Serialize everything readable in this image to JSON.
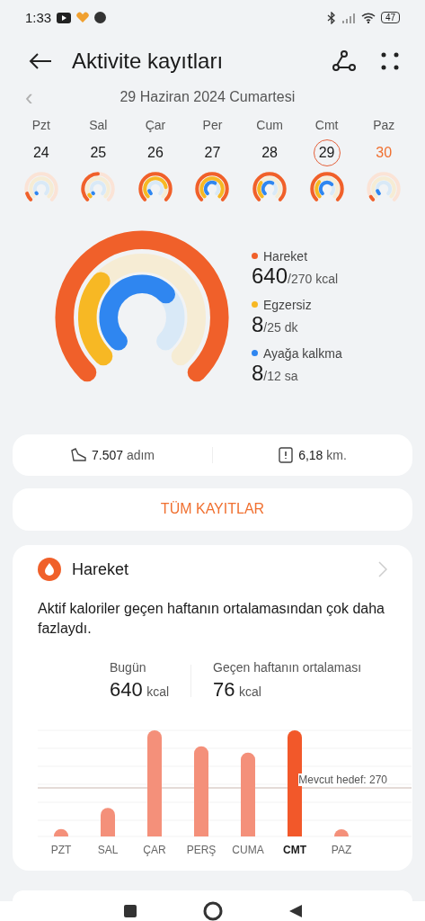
{
  "status_bar": {
    "time": "1:33",
    "battery": "47"
  },
  "header": {
    "title": "Aktivite kayıtları"
  },
  "date_nav": {
    "prev": "‹",
    "date": "29 Haziran 2024 Cumartesi"
  },
  "week": [
    {
      "weekday": "Pzt",
      "day": "24",
      "selected": false,
      "weekend": false
    },
    {
      "weekday": "Sal",
      "day": "25",
      "selected": false,
      "weekend": false
    },
    {
      "weekday": "Çar",
      "day": "26",
      "selected": false,
      "weekend": false
    },
    {
      "weekday": "Per",
      "day": "27",
      "selected": false,
      "weekend": false
    },
    {
      "weekday": "Cum",
      "day": "28",
      "selected": false,
      "weekend": false
    },
    {
      "weekday": "Cmt",
      "day": "29",
      "selected": true,
      "weekend": false
    },
    {
      "weekday": "Paz",
      "day": "30",
      "selected": false,
      "weekend": true
    }
  ],
  "summary": [
    {
      "label": "Hareket",
      "value": "640",
      "goal": "/270 kcal",
      "color": "#f0602a"
    },
    {
      "label": "Egzersiz",
      "value": "8",
      "goal": "/25 dk",
      "color": "#f7b824"
    },
    {
      "label": "Ayağa kalkma",
      "value": "8",
      "goal": "/12 sa",
      "color": "#2f86f0"
    }
  ],
  "totals": {
    "steps": "7.507",
    "steps_unit": "adım",
    "distance": "6,18",
    "distance_unit": "km."
  },
  "all_records_button": "TÜM KAYITLAR",
  "move_card": {
    "title": "Hareket",
    "message": "Aktif kaloriler geçen haftanın ortalamasından çok daha fazlaydı.",
    "today_label": "Bugün",
    "today_value": "640",
    "today_unit": "kcal",
    "avg_label": "Geçen haftanın ortalaması",
    "avg_value": "76",
    "avg_unit": "kcal",
    "goal_label": "Mevcut hedef: 270",
    "days": [
      {
        "label": "PZT",
        "selected": false
      },
      {
        "label": "SAL",
        "selected": false
      },
      {
        "label": "ÇAR",
        "selected": false
      },
      {
        "label": "PERŞ",
        "selected": false
      },
      {
        "label": "CUMA",
        "selected": false
      },
      {
        "label": "CMT",
        "selected": true
      },
      {
        "label": "PAZ",
        "selected": false
      }
    ]
  }
}
